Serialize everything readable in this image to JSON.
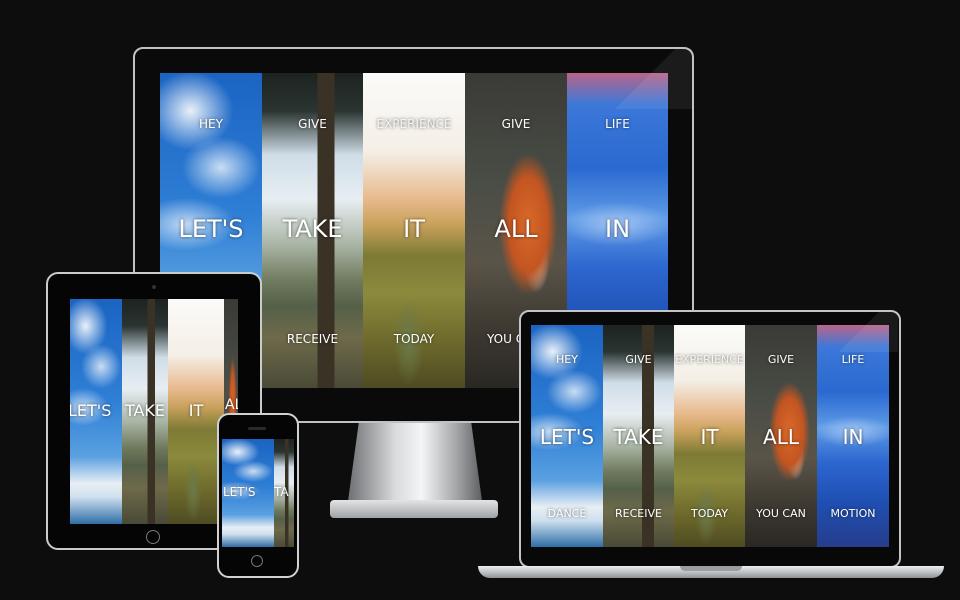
{
  "monitor": {
    "panels": [
      {
        "top": "HEY",
        "mid": "LET'S",
        "bottom": ""
      },
      {
        "top": "GIVE",
        "mid": "TAKE",
        "bottom": "RECEIVE"
      },
      {
        "top": "EXPERIENCE",
        "mid": "IT",
        "bottom": "TODAY"
      },
      {
        "top": "GIVE",
        "mid": "ALL",
        "bottom": "YOU C"
      },
      {
        "top": "LIFE",
        "mid": "IN",
        "bottom": ""
      }
    ]
  },
  "tablet": {
    "panels": [
      {
        "mid": "LET'S"
      },
      {
        "mid": "TAKE"
      },
      {
        "mid": "IT"
      },
      {
        "mid": "AL"
      }
    ]
  },
  "phone": {
    "panels": [
      {
        "mid": "LET'S"
      },
      {
        "mid": "TA"
      }
    ]
  },
  "laptop": {
    "panels": [
      {
        "top": "HEY",
        "mid": "LET'S",
        "bottom": "DANCE"
      },
      {
        "top": "GIVE",
        "mid": "TAKE",
        "bottom": "RECEIVE"
      },
      {
        "top": "EXPERIENCE",
        "mid": "IT",
        "bottom": "TODAY"
      },
      {
        "top": "GIVE",
        "mid": "ALL",
        "bottom": "YOU CAN"
      },
      {
        "top": "LIFE",
        "mid": "IN",
        "bottom": "MOTION"
      }
    ]
  }
}
